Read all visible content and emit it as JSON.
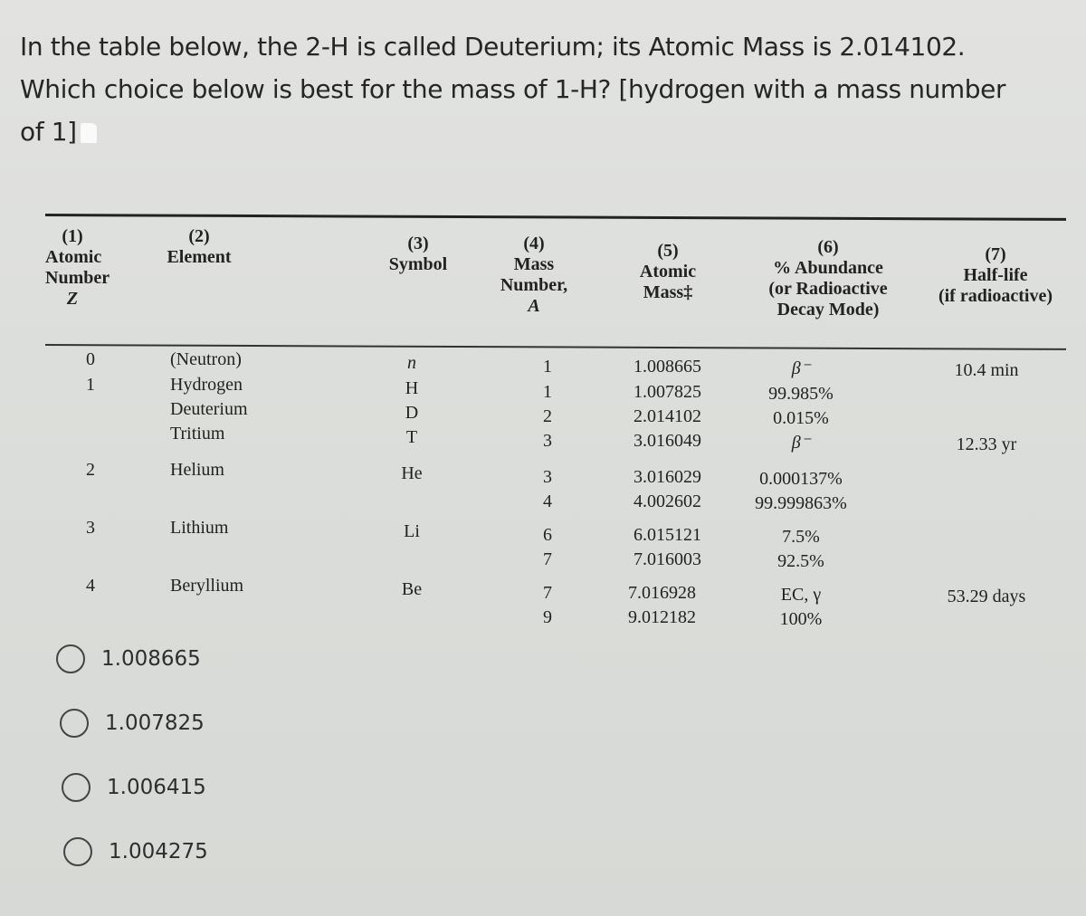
{
  "question": {
    "line1": "In the table below, the 2-H is called Deuterium; its Atomic Mass is 2.014102.",
    "line2": "Which choice below is best for the mass of 1-H? [hydrogen with a mass number",
    "line3": "of 1]"
  },
  "table": {
    "headers": [
      {
        "num": "(1)",
        "lines": [
          "Atomic",
          "Number"
        ],
        "var": "Z"
      },
      {
        "num": "(2)",
        "lines": [
          "Element"
        ],
        "var": ""
      },
      {
        "num": "(3)",
        "lines": [
          "Symbol"
        ],
        "var": ""
      },
      {
        "num": "(4)",
        "lines": [
          "Mass",
          "Number,"
        ],
        "var": "A"
      },
      {
        "num": "(5)",
        "lines": [
          "Atomic",
          "Mass‡"
        ],
        "var": ""
      },
      {
        "num": "(6)",
        "lines": [
          "% Abundance",
          "(or Radioactive",
          "Decay Mode)"
        ],
        "var": ""
      },
      {
        "num": "(7)",
        "lines": [
          "Half-life",
          "(if radioactive)"
        ],
        "var": ""
      }
    ],
    "groups": [
      {
        "z": "0",
        "elements": [
          "(Neutron)"
        ],
        "symbols": [
          "n"
        ],
        "isotopes": [
          {
            "A": "1",
            "mass": "1.008665",
            "abundance": "β⁻",
            "halflife": "10.4 min"
          }
        ]
      },
      {
        "z": "1",
        "elements": [
          "Hydrogen",
          "Deuterium",
          "Tritium"
        ],
        "symbols": [
          "H",
          "D",
          "T"
        ],
        "isotopes": [
          {
            "A": "1",
            "mass": "1.007825",
            "abundance": "99.985%",
            "halflife": ""
          },
          {
            "A": "2",
            "mass": "2.014102",
            "abundance": "0.015%",
            "halflife": ""
          },
          {
            "A": "3",
            "mass": "3.016049",
            "abundance": "β⁻",
            "halflife": "12.33 yr"
          }
        ]
      },
      {
        "z": "2",
        "elements": [
          "Helium"
        ],
        "symbols": [
          "He"
        ],
        "isotopes": [
          {
            "A": "3",
            "mass": "3.016029",
            "abundance": "0.000137%",
            "halflife": ""
          },
          {
            "A": "4",
            "mass": "4.002602",
            "abundance": "99.999863%",
            "halflife": ""
          }
        ]
      },
      {
        "z": "3",
        "elements": [
          "Lithium"
        ],
        "symbols": [
          "Li"
        ],
        "isotopes": [
          {
            "A": "6",
            "mass": "6.015121",
            "abundance": "7.5%",
            "halflife": ""
          },
          {
            "A": "7",
            "mass": "7.016003",
            "abundance": "92.5%",
            "halflife": ""
          }
        ]
      },
      {
        "z": "4",
        "elements": [
          "Beryllium"
        ],
        "symbols": [
          "Be"
        ],
        "isotopes": [
          {
            "A": "7",
            "mass": "7.016928",
            "abundance": "EC, γ",
            "halflife": "53.29 days"
          },
          {
            "A": "9",
            "mass": "9.012182",
            "abundance": "100%",
            "halflife": ""
          }
        ]
      }
    ]
  },
  "choices": [
    {
      "label": "1.008665",
      "selected": false
    },
    {
      "label": "1.007825",
      "selected": false
    },
    {
      "label": "1.006415",
      "selected": false
    },
    {
      "label": "1.004275",
      "selected": false
    }
  ]
}
